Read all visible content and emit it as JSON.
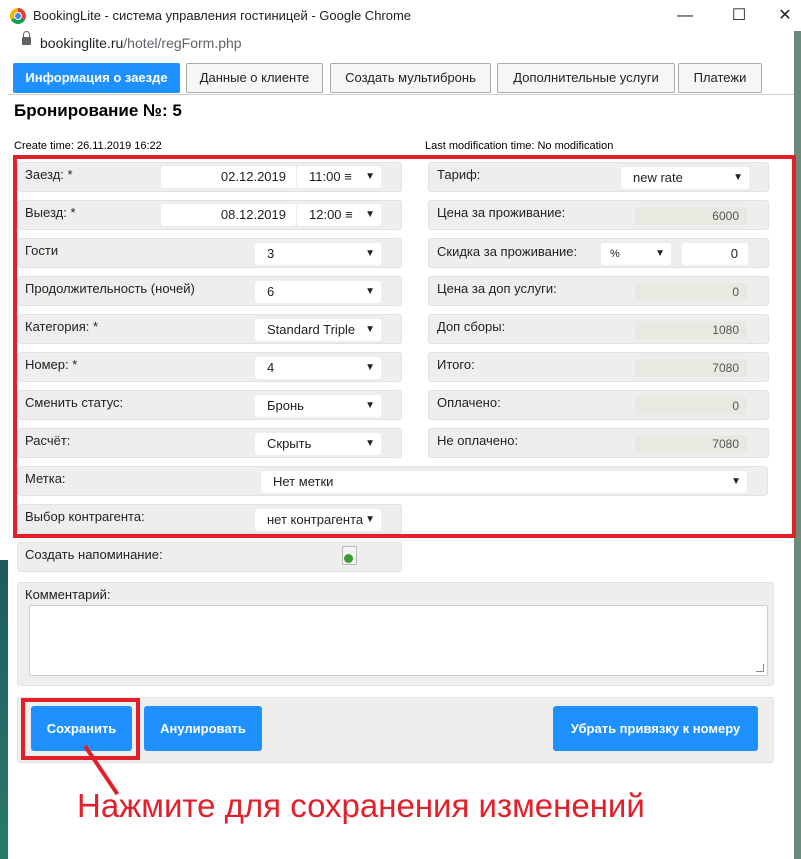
{
  "window": {
    "title": "BookingLite - система управления гостиницей - Google Chrome",
    "url_domain": "bookinglite.ru",
    "url_path": "/hotel/regForm.php"
  },
  "tabs": [
    "Информация о заезде",
    "Данные о клиенте",
    "Создать мультибронь",
    "Дополнительные услуги",
    "Платежи"
  ],
  "heading": "Бронирование №: 5",
  "create_time": "Create time: 26.11.2019 16:22",
  "modification_time": "Last modification time: No modification",
  "left_form": {
    "checkin_label": "Заезд: *",
    "checkin_date": "02.12.2019",
    "checkin_time": "11:00",
    "checkout_label": "Выезд: *",
    "checkout_date": "08.12.2019",
    "checkout_time": "12:00",
    "guests_label": "Гости",
    "guests_value": "3",
    "duration_label": "Продолжительность (ночей)",
    "duration_value": "6",
    "category_label": "Категория: *",
    "category_value": "Standard Triple",
    "room_label": "Номер: *",
    "room_value": "4",
    "status_label": "Сменить статус:",
    "status_value": "Бронь",
    "calc_label": "Расчёт:",
    "calc_value": "Скрыть",
    "tag_label": "Метка:",
    "tag_value": "Нет метки",
    "contractor_label": "Выбор контрагента:",
    "contractor_value": "нет контрагента",
    "reminder_label": "Создать напоминание:"
  },
  "right_form": {
    "tariff_label": "Тариф:",
    "tariff_value": "new rate",
    "price_label": "Цена за проживание:",
    "price_value": "6000",
    "discount_label": "Скидка за проживание:",
    "discount_type": "%",
    "discount_value": "0",
    "extra_services_label": "Цена за доп услуги:",
    "extra_services_value": "0",
    "fees_label": "Доп сборы:",
    "fees_value": "1080",
    "total_label": "Итого:",
    "total_value": "7080",
    "paid_label": "Оплачено:",
    "paid_value": "0",
    "unpaid_label": "Не оплачено:",
    "unpaid_value": "7080"
  },
  "comment_label": "Комментарий:",
  "buttons": {
    "save": "Сохранить",
    "cancel": "Анулировать",
    "unbind": "Убрать привязку к номеру"
  },
  "annotation_note": "Нажмите для сохранения изменений",
  "colors": {
    "accent": "#1e90ff",
    "highlight": "#e3202a"
  }
}
